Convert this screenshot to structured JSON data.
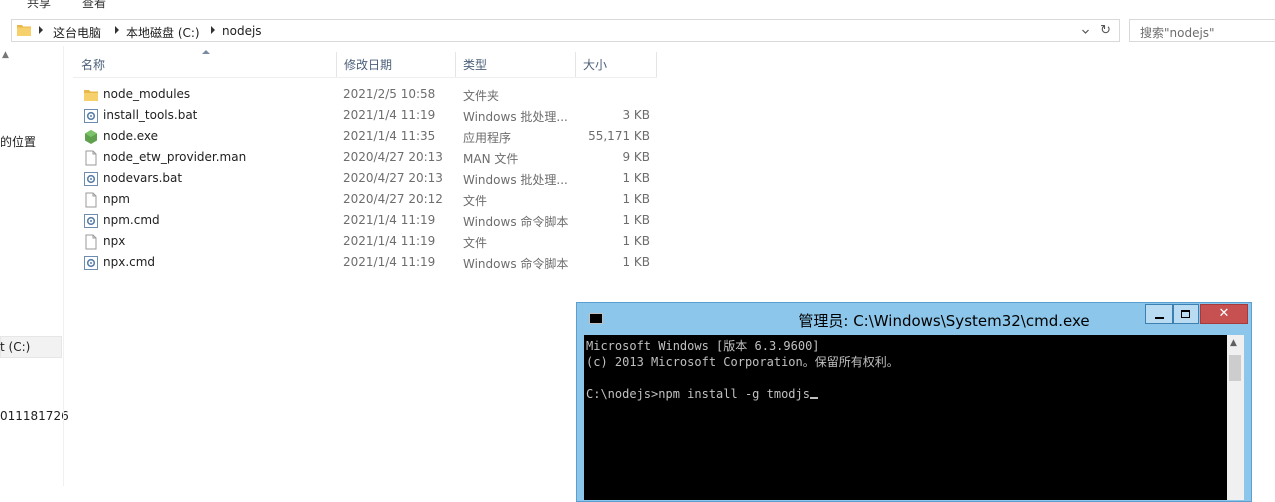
{
  "ribbon": {
    "share": "共享",
    "view": "查看"
  },
  "address": {
    "crumbs": [
      "这台电脑",
      "本地磁盘 (C:)",
      "nodejs"
    ],
    "search_placeholder": "搜索\"nodejs\""
  },
  "nav": {
    "fragment_location": "的位置",
    "fragment_drive": "t (C:)",
    "fragment_number": "011181726"
  },
  "columns": {
    "name": "名称",
    "date": "修改日期",
    "type": "类型",
    "size": "大小"
  },
  "files": [
    {
      "name": "node_modules",
      "date": "2021/2/5 10:58",
      "type": "文件夹",
      "size": "",
      "icon": "folder-icon"
    },
    {
      "name": "install_tools.bat",
      "date": "2021/1/4 11:19",
      "type": "Windows 批处理...",
      "size": "3 KB",
      "icon": "batch-file-icon"
    },
    {
      "name": "node.exe",
      "date": "2021/1/4 11:35",
      "type": "应用程序",
      "size": "55,171 KB",
      "icon": "nodejs-icon"
    },
    {
      "name": "node_etw_provider.man",
      "date": "2020/4/27 20:13",
      "type": "MAN 文件",
      "size": "9 KB",
      "icon": "file-icon"
    },
    {
      "name": "nodevars.bat",
      "date": "2020/4/27 20:13",
      "type": "Windows 批处理...",
      "size": "1 KB",
      "icon": "batch-file-icon"
    },
    {
      "name": "npm",
      "date": "2020/4/27 20:12",
      "type": "文件",
      "size": "1 KB",
      "icon": "file-icon"
    },
    {
      "name": "npm.cmd",
      "date": "2021/1/4 11:19",
      "type": "Windows 命令脚本",
      "size": "1 KB",
      "icon": "batch-file-icon"
    },
    {
      "name": "npx",
      "date": "2021/1/4 11:19",
      "type": "文件",
      "size": "1 KB",
      "icon": "file-icon"
    },
    {
      "name": "npx.cmd",
      "date": "2021/1/4 11:19",
      "type": "Windows 命令脚本",
      "size": "1 KB",
      "icon": "batch-file-icon"
    }
  ],
  "cmd": {
    "title": "管理员: C:\\Windows\\System32\\cmd.exe",
    "lines": [
      "Microsoft Windows [版本 6.3.9600]",
      "(c) 2013 Microsoft Corporation。保留所有权利。",
      "",
      "C:\\nodejs>npm install -g tmodjs"
    ]
  },
  "colors": {
    "cmd_frame": "#8cc6ea",
    "close_button": "#c75050",
    "header_text": "#4c607a"
  }
}
